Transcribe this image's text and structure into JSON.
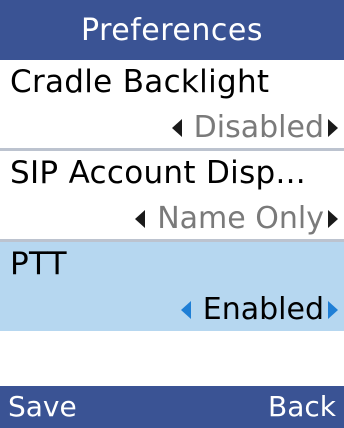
{
  "title": "Preferences",
  "items": [
    {
      "label": "Cradle Backlight",
      "value": "Disabled"
    },
    {
      "label": "SIP Account Disp...",
      "value": "Name Only"
    },
    {
      "label": "PTT",
      "value": "Enabled"
    }
  ],
  "softkeys": {
    "left": "Save",
    "right": "Back"
  },
  "colors": {
    "bar": "#3a5394",
    "selected_bg": "#b6d7f0",
    "selected_arrow": "#1f7fd6"
  },
  "icons": {
    "prev": "triangle-left-icon",
    "next": "triangle-right-icon"
  }
}
